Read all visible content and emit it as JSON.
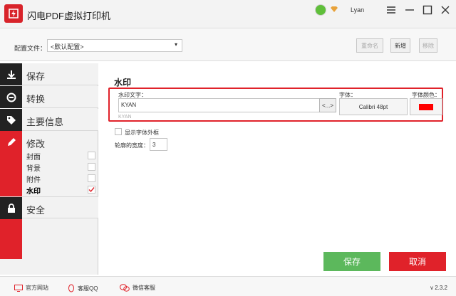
{
  "app": {
    "title": "闪电PDF虚拟打印机",
    "user": "Lyan",
    "version": "v 2.3.2"
  },
  "config": {
    "label": "配置文件：",
    "selected": "<默认配置>",
    "rename_label": "重命名",
    "new_label": "新增",
    "remove_label": "移除"
  },
  "sidebar": {
    "items": [
      {
        "label": "保存",
        "icon": "download-icon"
      },
      {
        "label": "转换",
        "icon": "convert-icon"
      },
      {
        "label": "主要信息",
        "icon": "tag-icon"
      },
      {
        "label": "修改",
        "icon": "pencil-icon"
      },
      {
        "label": "安全",
        "icon": "lock-icon"
      }
    ],
    "sub_items": [
      {
        "label": "封面",
        "checked": false
      },
      {
        "label": "背景",
        "checked": false
      },
      {
        "label": "附件",
        "checked": false
      },
      {
        "label": "水印",
        "checked": true
      }
    ]
  },
  "watermark": {
    "section_title": "水印",
    "text_label": "水印文字：",
    "text_value": "KYAN",
    "text_hint": "KYAN",
    "browse_label": "<...>",
    "font_label": "字体：",
    "font_value": "Calibri 48pt",
    "color_label": "字体颜色：",
    "color_value": "#ff0000",
    "frame_label": "显示字体外框",
    "frame_checked": false,
    "outline_label": "轮廓的宽度：",
    "outline_value": "3"
  },
  "actions": {
    "save_label": "保存",
    "cancel_label": "取消"
  },
  "footer": {
    "website_label": "官方网站",
    "qq_label": "客服QQ",
    "wechat_label": "微信客服"
  },
  "colors": {
    "brand_red": "#e0222a",
    "save_green": "#5cb85c",
    "nav_dark": "#222222"
  }
}
